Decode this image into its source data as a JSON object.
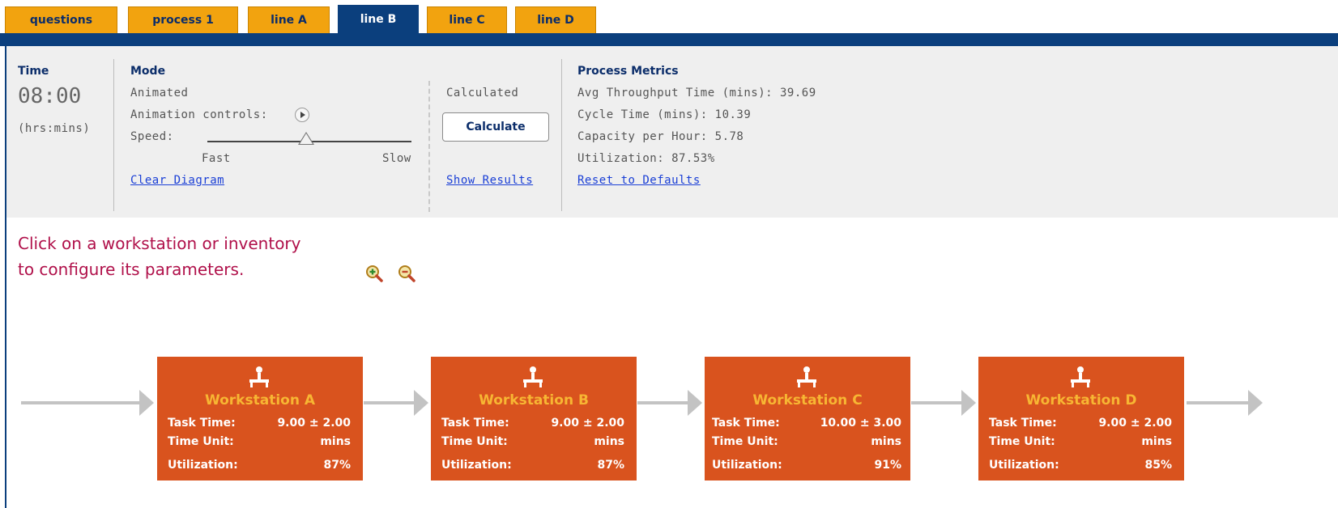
{
  "tabs": [
    {
      "label": "questions",
      "active": false
    },
    {
      "label": "process 1",
      "active": false
    },
    {
      "label": "line A",
      "active": false
    },
    {
      "label": "line B",
      "active": true
    },
    {
      "label": "line C",
      "active": false
    },
    {
      "label": "line D",
      "active": false
    }
  ],
  "time": {
    "heading": "Time",
    "value": "08:00",
    "unit": "(hrs:mins)"
  },
  "mode": {
    "heading": "Mode",
    "animated_label": "Animated",
    "animation_controls_label": "Animation controls:",
    "speed_label": "Speed:",
    "speed_fast": "Fast",
    "speed_slow": "Slow",
    "speed_level": 0.48,
    "clear_diagram": "Clear Diagram",
    "calculated_label": "Calculated",
    "calculate_button": "Calculate",
    "show_results": "Show Results"
  },
  "metrics": {
    "heading": "Process Metrics",
    "avg_throughput": "Avg Throughput Time (mins): 39.69",
    "cycle_time": "Cycle Time (mins): 10.39",
    "capacity": "Capacity per Hour: 5.78",
    "utilization": "Utilization: 87.53%",
    "reset": "Reset to Defaults"
  },
  "instructions": {
    "line1": "Click on a workstation or inventory",
    "line2": "to configure its parameters."
  },
  "workstations": [
    {
      "name": "Workstation A",
      "task_time_label": "Task Time:",
      "task_time": "9.00 ± 2.00",
      "time_unit_label": "Time Unit:",
      "time_unit": "mins",
      "utilization_label": "Utilization:",
      "utilization": "87%"
    },
    {
      "name": "Workstation B",
      "task_time_label": "Task Time:",
      "task_time": "9.00 ± 2.00",
      "time_unit_label": "Time Unit:",
      "time_unit": "mins",
      "utilization_label": "Utilization:",
      "utilization": "87%"
    },
    {
      "name": "Workstation C",
      "task_time_label": "Task Time:",
      "task_time": "10.00 ± 3.00",
      "time_unit_label": "Time Unit:",
      "time_unit": "mins",
      "utilization_label": "Utilization:",
      "utilization": "91%"
    },
    {
      "name": "Workstation D",
      "task_time_label": "Task Time:",
      "task_time": "9.00 ± 2.00",
      "time_unit_label": "Time Unit:",
      "time_unit": "mins",
      "utilization_label": "Utilization:",
      "utilization": "85%"
    }
  ],
  "colors": {
    "tab": "#f2a30f",
    "tab_active": "#0b3f7d",
    "workstation": "#d9531e",
    "workstation_title": "#f7b633",
    "instruction_text": "#b0104a",
    "link": "#1a3fd6"
  }
}
